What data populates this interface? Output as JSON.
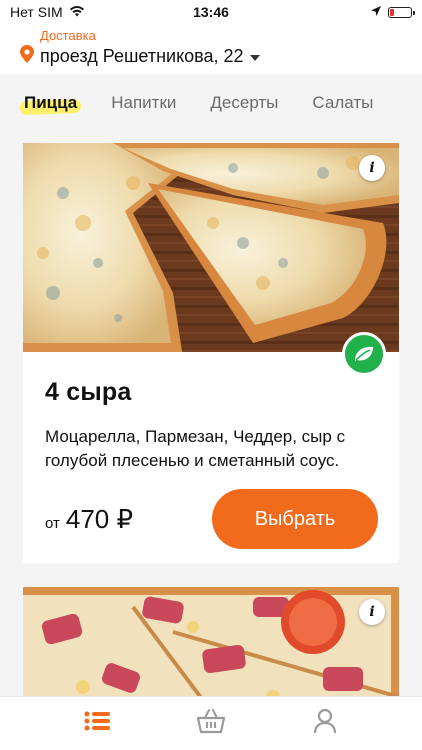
{
  "status_bar": {
    "carrier": "Нет SIM",
    "time": "13:46",
    "battery_level": 0.2,
    "battery_color": "#e53935"
  },
  "header": {
    "delivery_label": "Доставка",
    "address": "проезд Решетникова, 22",
    "icons": [
      "location-pin-icon",
      "chevron-down-icon"
    ]
  },
  "categories": {
    "items": [
      "Пицца",
      "Напитки",
      "Десерты",
      "Салаты"
    ],
    "active": "Пицца"
  },
  "products": [
    {
      "name": "4 сыра",
      "description": " Моцарелла, Пармезан, Чеддер, сыр с голубой плесенью и сметанный соус.",
      "price_prefix": "от",
      "price": "470 ₽",
      "button_label": "Выбрать",
      "info_label": "i",
      "badge": "vegetarian-leaf-icon"
    },
    {
      "info_label": "i"
    }
  ],
  "bottom_nav": {
    "items": [
      "menu-list-icon",
      "basket-icon",
      "profile-icon"
    ],
    "active": "menu-list-icon"
  },
  "colors": {
    "accent": "#f26b1d",
    "veg_badge": "#20b14a",
    "tab_highlight": "#fff06a",
    "inactive_nav": "#9a9a9a"
  }
}
